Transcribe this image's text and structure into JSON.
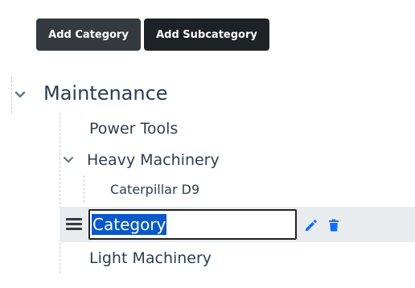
{
  "toolbar": {
    "add_category_label": "Add Category",
    "add_subcategory_label": "Add Subcategory"
  },
  "tree": {
    "root": {
      "label": "Maintenance",
      "expanded": true
    },
    "children": [
      {
        "label": "Power Tools"
      },
      {
        "label": "Heavy Machinery",
        "expanded": true,
        "children": [
          {
            "label": "Caterpillar D9"
          }
        ]
      },
      {
        "editing": true,
        "input_value": "Category"
      },
      {
        "label": "Light Machinery"
      }
    ]
  },
  "colors": {
    "accent_icon": "#0d6efd",
    "selection": "#0a58ca",
    "dark_button": "#343a40"
  },
  "icons": [
    "chevron-down-icon",
    "drag-handle-icon",
    "pencil-icon",
    "trash-icon"
  ]
}
